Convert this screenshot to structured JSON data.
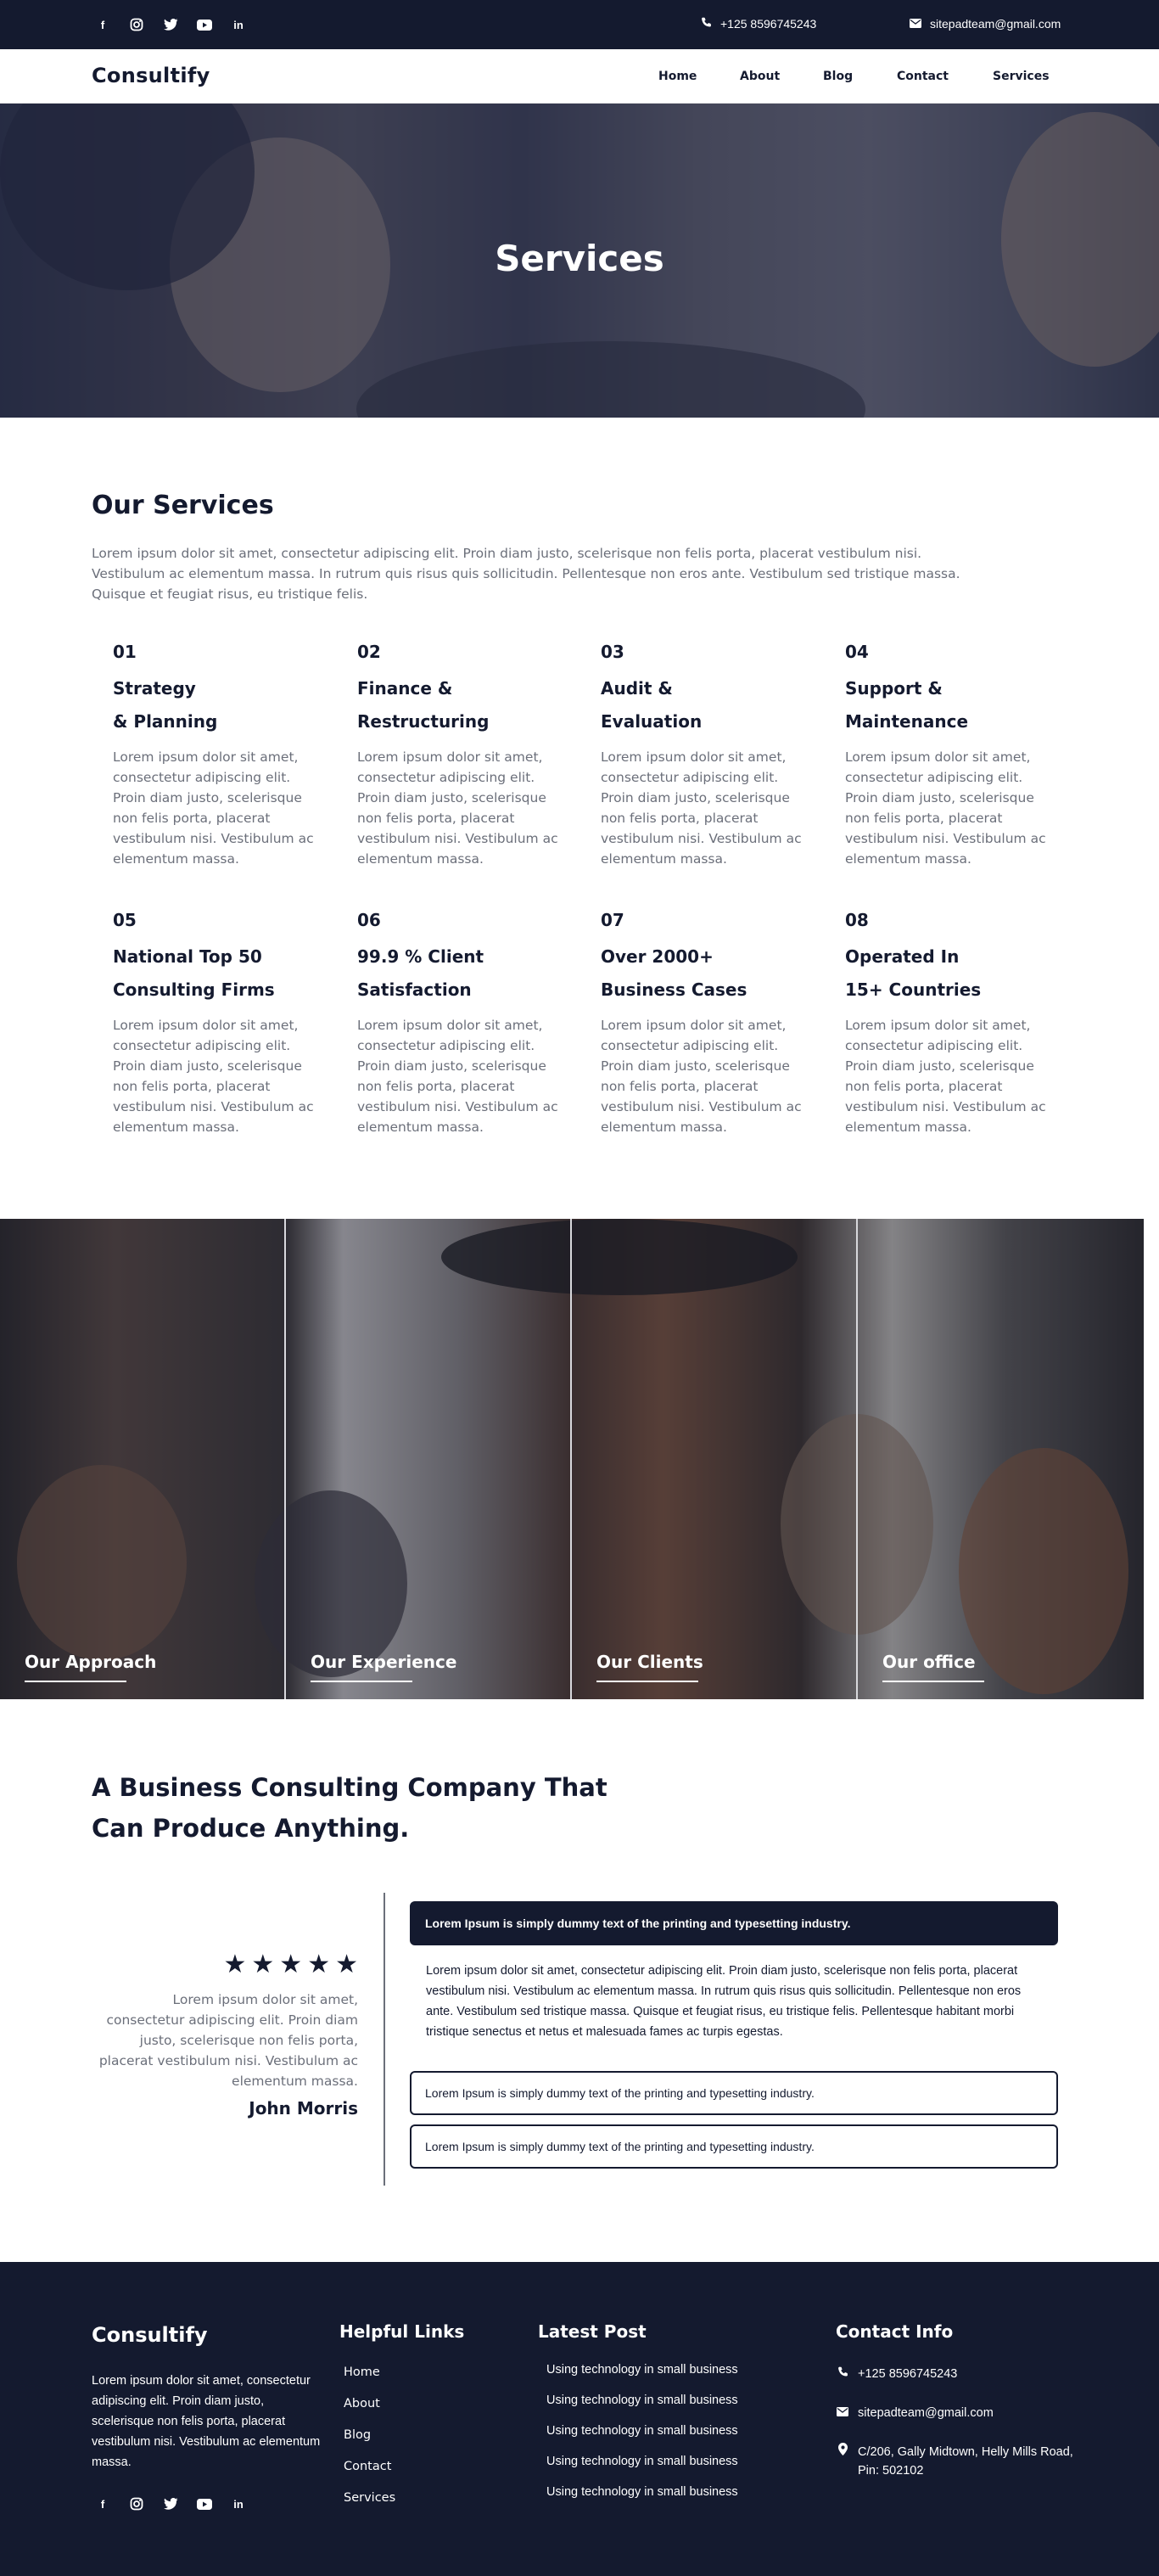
{
  "topbar": {
    "social": [
      "facebook-icon",
      "instagram-icon",
      "twitter-icon",
      "youtube-icon",
      "linkedin-icon"
    ],
    "phone": "+125 8596745243",
    "email": "sitepadteam@gmail.com"
  },
  "nav": {
    "logo": "Consultify",
    "items": [
      "Home",
      "About",
      "Blog",
      "Contact",
      "Services"
    ]
  },
  "hero": {
    "title": "Services"
  },
  "services": {
    "title": "Our Services",
    "intro": "Lorem ipsum dolor sit amet, consectetur adipiscing elit. Proin diam justo, scelerisque non felis porta, placerat vestibulum nisi. Vestibulum ac elementum massa. In rutrum quis risus quis sollicitudin. Pellentesque non eros ante. Vestibulum sed tristique massa. Quisque et feugiat risus, eu tristique felis.",
    "items": [
      {
        "num": "01",
        "line1": "Strategy",
        "line2": "& Planning",
        "desc": "Lorem ipsum dolor sit amet, consectetur adipiscing elit. Proin diam justo, scelerisque non felis porta, placerat vestibulum nisi. Vestibulum ac elementum massa."
      },
      {
        "num": "02",
        "line1": "Finance &",
        "line2": "Restructuring",
        "desc": "Lorem ipsum dolor sit amet, consectetur adipiscing elit. Proin diam justo, scelerisque non felis porta, placerat vestibulum nisi. Vestibulum ac elementum massa."
      },
      {
        "num": "03",
        "line1": "Audit &",
        "line2": "Evaluation",
        "desc": "Lorem ipsum dolor sit amet, consectetur adipiscing elit. Proin diam justo, scelerisque non felis porta, placerat vestibulum nisi. Vestibulum ac elementum massa."
      },
      {
        "num": "04",
        "line1": "Support &",
        "line2": "Maintenance",
        "desc": "Lorem ipsum dolor sit amet, consectetur adipiscing elit. Proin diam justo, scelerisque non felis porta, placerat vestibulum nisi. Vestibulum ac elementum massa."
      },
      {
        "num": "05",
        "line1": "National Top 50",
        "line2": "Consulting Firms",
        "desc": "Lorem ipsum dolor sit amet, consectetur adipiscing elit. Proin diam justo, scelerisque non felis porta, placerat vestibulum nisi. Vestibulum ac elementum massa."
      },
      {
        "num": "06",
        "line1": "99.9 % Client",
        "line2": "Satisfaction",
        "desc": "Lorem ipsum dolor sit amet, consectetur adipiscing elit. Proin diam justo, scelerisque non felis porta, placerat vestibulum nisi. Vestibulum ac elementum massa."
      },
      {
        "num": "07",
        "line1": "Over 2000+",
        "line2": "Business Cases",
        "desc": "Lorem ipsum dolor sit amet, consectetur adipiscing elit. Proin diam justo, scelerisque non felis porta, placerat vestibulum nisi. Vestibulum ac elementum massa."
      },
      {
        "num": "08",
        "line1": "Operated In",
        "line2": "15+ Countries",
        "desc": "Lorem ipsum dolor sit amet, consectetur adipiscing elit. Proin diam justo, scelerisque non felis porta, placerat vestibulum nisi. Vestibulum ac elementum massa."
      }
    ]
  },
  "panels": [
    "Our Approach",
    "Our Experience",
    "Our Clients",
    "Our office"
  ],
  "business": {
    "title": "A Business Consulting Company That Can Produce Anything.",
    "stars": [
      "★",
      "★",
      "★",
      "★",
      "★"
    ],
    "rating": 5,
    "testimonial": "Lorem ipsum dolor sit amet, consectetur adipiscing elit. Proin diam justo, scelerisque non felis porta, placerat vestibulum nisi. Vestibulum ac elementum massa.",
    "author": "John Morris",
    "accordion": [
      {
        "title": "Lorem Ipsum is simply dummy text of the printing and typesetting industry.",
        "body": "Lorem ipsum dolor sit amet, consectetur adipiscing elit. Proin diam justo, scelerisque non felis porta, placerat vestibulum nisi. Vestibulum ac elementum massa. In rutrum quis risus quis sollicitudin. Pellentesque non eros ante. Vestibulum sed tristique massa. Quisque et feugiat risus, eu tristique felis. Pellentesque habitant morbi tristique senectus et netus et malesuada fames ac turpis egestas."
      },
      {
        "title": "Lorem Ipsum is simply dummy text of the printing and typesetting industry."
      },
      {
        "title": "Lorem Ipsum is simply dummy text of the printing and typesetting industry."
      }
    ]
  },
  "footer": {
    "logo": "Consultify",
    "about": "Lorem ipsum dolor sit amet, consectetur adipiscing elit. Proin diam justo, scelerisque non felis porta, placerat vestibulum nisi. Vestibulum ac elementum massa.",
    "links_title": "Helpful Links",
    "links": [
      "Home",
      "About",
      "Blog",
      "Contact",
      "Services"
    ],
    "posts_title": "Latest Post",
    "posts": [
      "Using technology in small business",
      "Using technology in small business",
      "Using technology in small business",
      "Using technology in small business",
      "Using technology in small business"
    ],
    "contact_title": "Contact Info",
    "phone": "+125 8596745243",
    "email": "sitepadteam@gmail.com",
    "address": "C/206, Gally Midtown, Helly Mills Road, Pin: 502102"
  },
  "colors": {
    "navy": "#141a2f",
    "text_gray": "#6b6f7a",
    "white": "#ffffff"
  }
}
